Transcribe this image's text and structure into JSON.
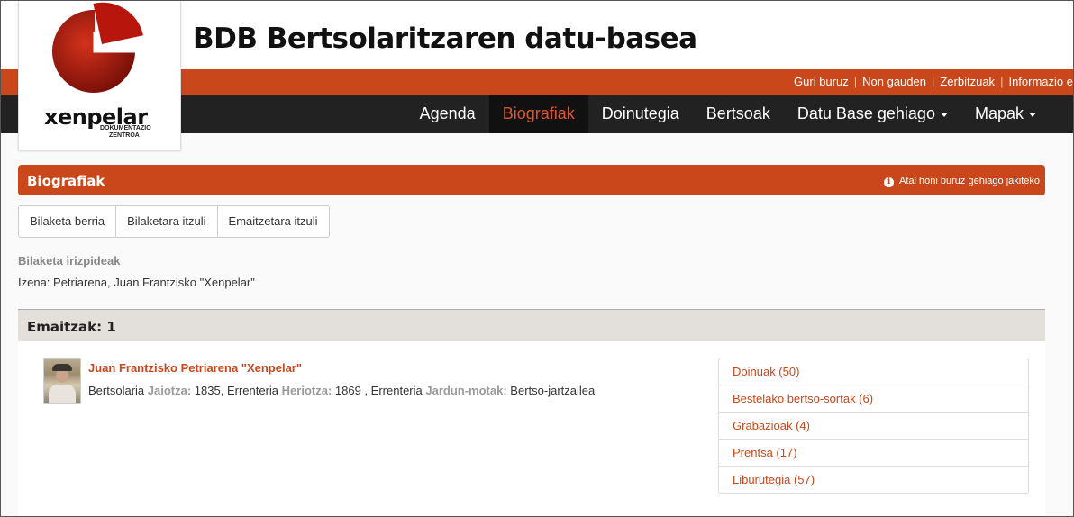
{
  "header": {
    "site_title": "BDB Bertsolaritzaren datu-basea",
    "logo_name": "xenpelar",
    "logo_sub_1": "DOKUMENTAZIO",
    "logo_sub_2": "ZENTROA",
    "top_links": [
      "Guri buruz",
      "Non gauden",
      "Zerbitzuak",
      "Informazio e"
    ]
  },
  "nav": {
    "items": [
      {
        "label": "Agenda",
        "active": false
      },
      {
        "label": "Biografiak",
        "active": true
      },
      {
        "label": "Doinutegia",
        "active": false
      },
      {
        "label": "Bertsoak",
        "active": false
      },
      {
        "label": "Datu Base gehiago",
        "active": false,
        "dropdown": true
      },
      {
        "label": "Mapak",
        "active": false,
        "dropdown": true
      }
    ]
  },
  "panel": {
    "title": "Biografiak",
    "info_link": "Atal honi buruz gehiago jakiteko"
  },
  "buttons": [
    "Bilaketa berria",
    "Bilaketara itzuli",
    "Emaitzetara itzuli"
  ],
  "criteria": {
    "label": "Bilaketa irizpideak",
    "value": "Izena: Petriarena, Juan Frantzisko \"Xenpelar\""
  },
  "results": {
    "title": "Emaitzak: 1",
    "person": {
      "name": "Juan Frantzisko Petriarena \"Xenpelar\"",
      "role": "Bertsolaria",
      "birth_label": "Jaiotza:",
      "birth_value": "1835, Errenteria",
      "death_label": "Heriotza:",
      "death_value": "1869 , Errenteria",
      "activity_label": "Jardun-motak:",
      "activity_value": "Bertso-jartzailea"
    },
    "links": [
      "Doinuak (50)",
      "Bestelako bertso-sortak (6)",
      "Grabazioak (4)",
      "Prentsa (17)",
      "Liburutegia (57)"
    ]
  },
  "colors": {
    "accent": "#c9471a",
    "nav_bg": "#222222"
  }
}
